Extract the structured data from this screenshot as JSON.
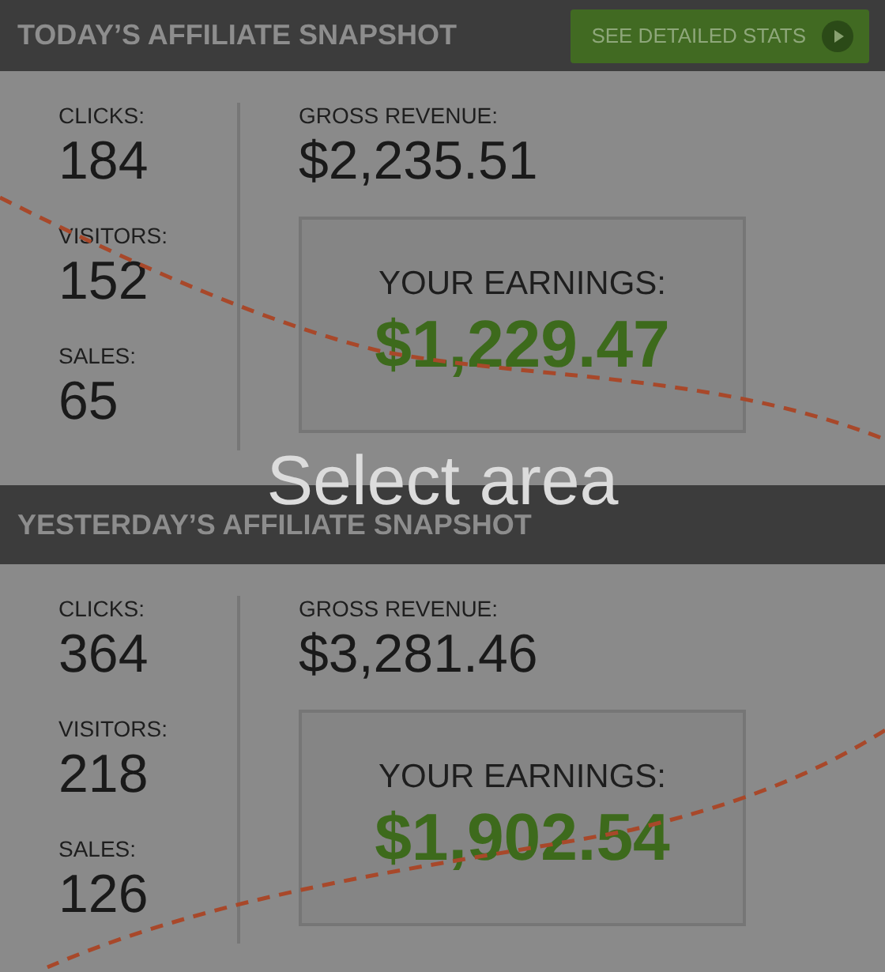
{
  "sections": [
    {
      "title": "TODAY’S AFFILIATE SNAPSHOT",
      "button": {
        "label": "SEE DETAILED STATS"
      },
      "stats": [
        {
          "label": "CLICKS:",
          "value": "184"
        },
        {
          "label": "VISITORS:",
          "value": "152"
        },
        {
          "label": "SALES:",
          "value": "65"
        }
      ],
      "gross_revenue": {
        "label": "GROSS REVENUE:",
        "value": "$2,235.51"
      },
      "earnings": {
        "label": "YOUR EARNINGS:",
        "value": "$1,229.47"
      }
    },
    {
      "title": "YESTERDAY’S AFFILIATE SNAPSHOT",
      "stats": [
        {
          "label": "CLICKS:",
          "value": "364"
        },
        {
          "label": "VISITORS:",
          "value": "218"
        },
        {
          "label": "SALES:",
          "value": "126"
        }
      ],
      "gross_revenue": {
        "label": "GROSS REVENUE:",
        "value": "$3,281.46"
      },
      "earnings": {
        "label": "YOUR EARNINGS:",
        "value": "$1,902.54"
      }
    }
  ],
  "overlay": {
    "hint": "Select area"
  }
}
